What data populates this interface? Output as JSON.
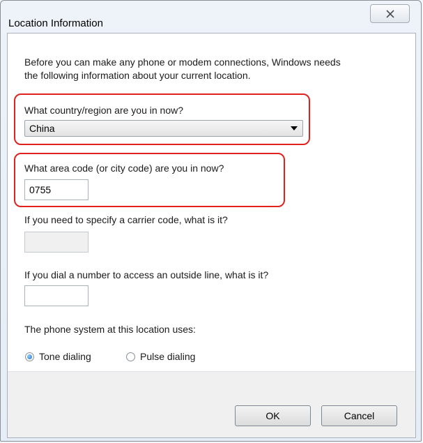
{
  "window": {
    "title": "Location Information"
  },
  "intro": {
    "line1": "Before you can make any phone or modem connections, Windows needs",
    "line2": "the following information about your current location."
  },
  "country": {
    "label": "What country/region are you in now?",
    "value": "China"
  },
  "area_code": {
    "label": "What area code (or city code) are you in now?",
    "value": "0755"
  },
  "carrier_code": {
    "label": "If you need to specify a carrier code, what is it?",
    "value": ""
  },
  "outside_line": {
    "label": "If you dial a number to access an outside line, what is it?",
    "value": ""
  },
  "dialing": {
    "label": "The phone system at this location uses:",
    "options": [
      "Tone dialing",
      "Pulse dialing"
    ],
    "selected": "Tone dialing"
  },
  "buttons": {
    "ok": "OK",
    "cancel": "Cancel"
  },
  "icons": {
    "close": "close-icon",
    "dropdown": "chevron-down-icon"
  },
  "colors": {
    "highlight": "#e0221f",
    "radio_selected": "#1d6fc2"
  }
}
